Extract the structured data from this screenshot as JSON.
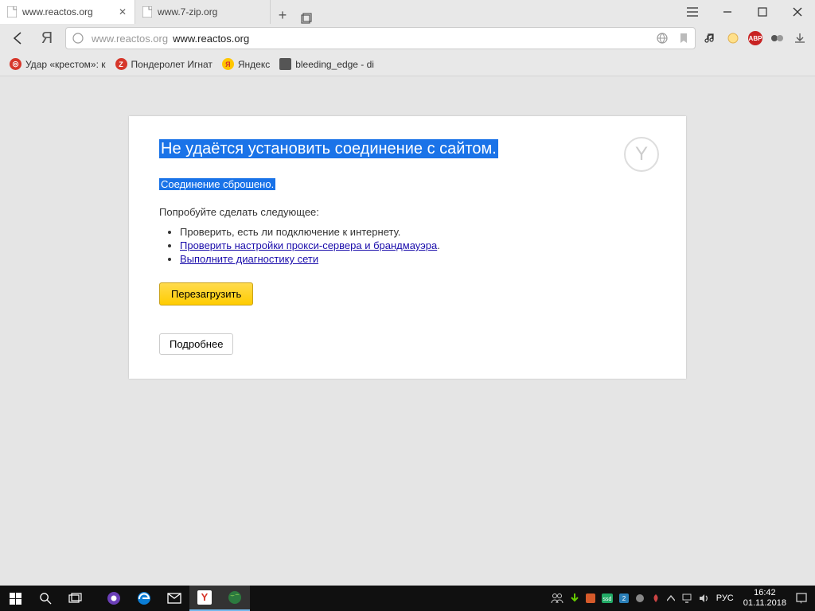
{
  "tabs": [
    {
      "title": "www.reactos.org",
      "active": true
    },
    {
      "title": "www.7-zip.org",
      "active": false
    }
  ],
  "address": {
    "gray_part": "www.reactos.org",
    "dark_part": "www.reactos.org"
  },
  "bookmarks": [
    {
      "label": "Удар «крестом»: к"
    },
    {
      "label": "Пондеролет Игнат"
    },
    {
      "label": "Яндекс"
    },
    {
      "label": "bleeding_edge - di"
    }
  ],
  "error": {
    "title": "Не удаётся установить соединение с сайтом.",
    "subtitle": "Соединение сброшено.",
    "try_label": "Попробуйте сделать следующее:",
    "items": [
      {
        "text": "Проверить, есть ли подключение к интернету.",
        "link": false
      },
      {
        "text": "Проверить настройки прокси-сервера и брандмауэра",
        "link": true,
        "suffix": "."
      },
      {
        "text": "Выполните диагностику сети",
        "link": true,
        "suffix": ""
      }
    ],
    "reload": "Перезагрузить",
    "details": "Подробнее"
  },
  "taskbar": {
    "lang": "РУС",
    "time": "16:42",
    "date": "01.11.2018"
  }
}
